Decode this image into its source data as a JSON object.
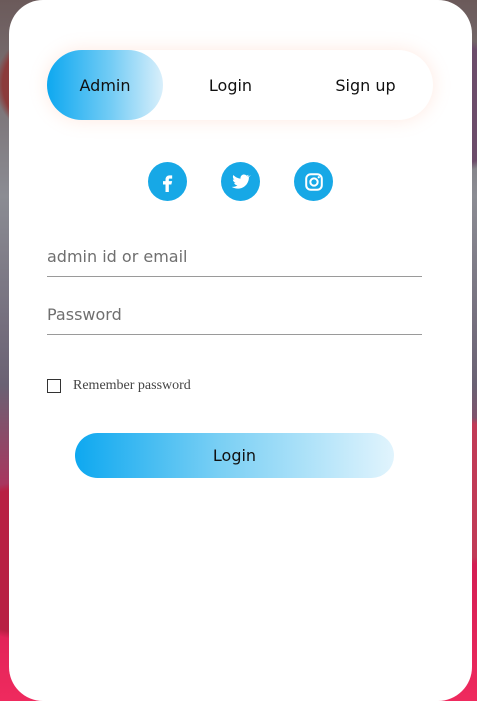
{
  "tabs": {
    "admin": "Admin",
    "login": "Login",
    "signup": "Sign up"
  },
  "social": {
    "facebook": "facebook-icon",
    "twitter": "twitter-icon",
    "instagram": "instagram-icon",
    "accent": "#17a8e6"
  },
  "form": {
    "email_placeholder": "admin id or email",
    "password_placeholder": "Password",
    "remember_label": "Remember password",
    "login_button": "Login"
  }
}
